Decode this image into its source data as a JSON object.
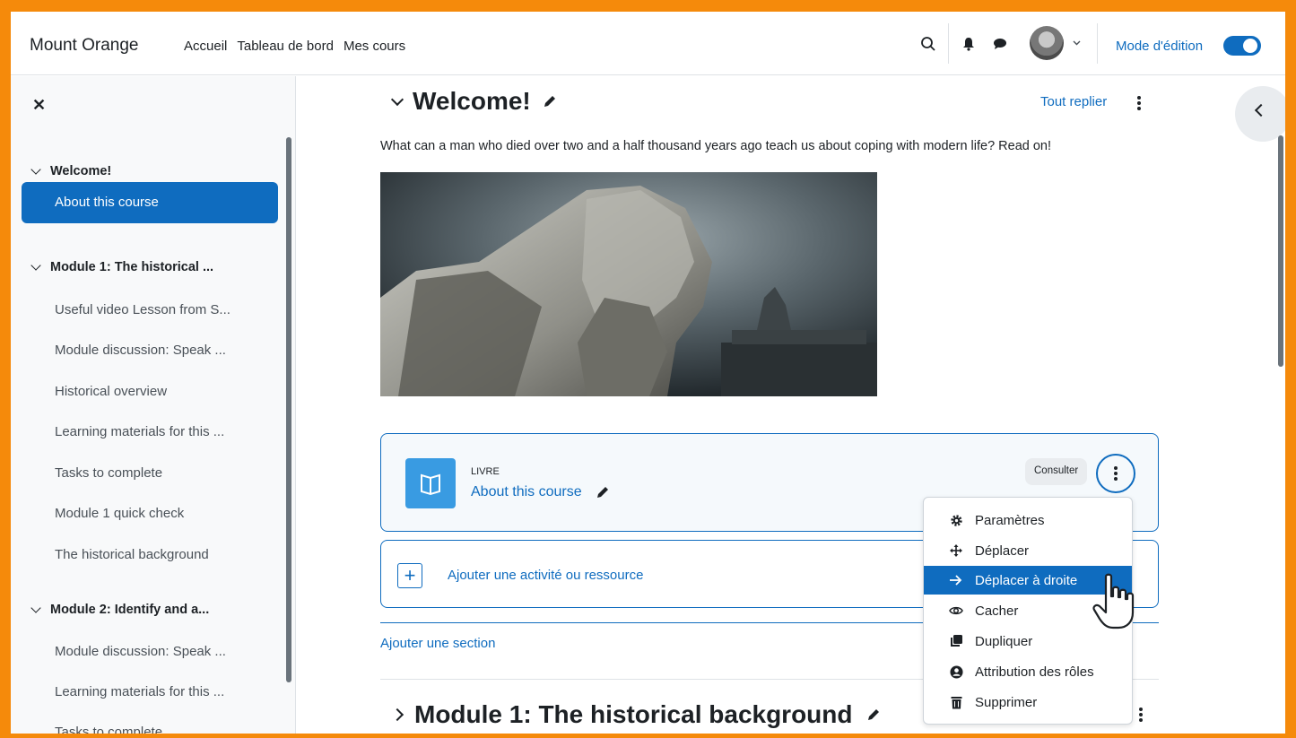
{
  "navbar": {
    "brand": "Mount Orange",
    "links": [
      "Accueil",
      "Tableau de bord",
      "Mes cours"
    ],
    "edit_mode_label": "Mode d'édition",
    "edit_mode_on": true
  },
  "sidebar": {
    "sections": [
      {
        "title": "Welcome!",
        "items": [
          "About this course"
        ]
      },
      {
        "title": "Module 1: The historical ...",
        "items": [
          "Useful video Lesson from S...",
          "Module discussion: Speak ...",
          "Historical overview",
          "Learning materials for this ...",
          "Tasks to complete",
          "Module 1 quick check",
          "The historical background"
        ]
      },
      {
        "title": "Module 2: Identify and a...",
        "items": [
          "Module discussion: Speak ...",
          "Learning materials for this ...",
          "Tasks to complete"
        ]
      }
    ],
    "active_item": "About this course"
  },
  "main": {
    "section_title": "Welcome!",
    "collapse_all": "Tout replier",
    "intro": "What can a man who died over two and a half thousand years ago teach us about coping with modern life? Read on!",
    "activity": {
      "type": "LIVRE",
      "name": "About this course",
      "badge": "Consulter"
    },
    "add_activity": "Ajouter une activité ou ressource",
    "add_section": "Ajouter une section",
    "next_section_title": "Module 1: The historical background"
  },
  "menu": {
    "items": [
      {
        "label": "Paramètres",
        "icon": "gear-icon"
      },
      {
        "label": "Déplacer",
        "icon": "move-arrows-icon"
      },
      {
        "label": "Déplacer à droite",
        "icon": "arrow-right-icon",
        "active": true
      },
      {
        "label": "Cacher",
        "icon": "eye-icon"
      },
      {
        "label": "Dupliquer",
        "icon": "copy-icon"
      },
      {
        "label": "Attribution des rôles",
        "icon": "user-circle-icon"
      },
      {
        "label": "Supprimer",
        "icon": "trash-icon"
      }
    ]
  },
  "colors": {
    "accent": "#0f6cbf",
    "frame": "#f58a0b",
    "activity_icon": "#399be2"
  }
}
